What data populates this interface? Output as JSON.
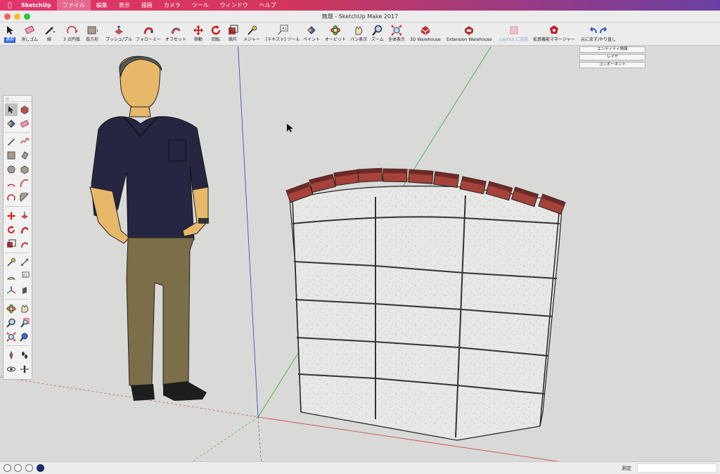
{
  "menubar": {
    "app_name": "SketchUp",
    "items": [
      "ファイル",
      "編集",
      "表示",
      "描画",
      "カメラ",
      "ツール",
      "ウィンドウ",
      "ヘルプ"
    ]
  },
  "window": {
    "title": "無題 - SketchUp Make 2017"
  },
  "toolbar": {
    "tools": [
      {
        "label": "選択",
        "icon": "select-arrow-icon"
      },
      {
        "label": "消しゴム",
        "icon": "eraser-icon"
      },
      {
        "label": "線",
        "icon": "pencil-icon"
      },
      {
        "label": "3 点円弧",
        "icon": "arc-icon"
      },
      {
        "label": "長方形",
        "icon": "rectangle-icon"
      },
      {
        "label": "プッシュ/プル",
        "icon": "push-pull-icon"
      },
      {
        "label": "フォローミー",
        "icon": "follow-me-icon"
      },
      {
        "label": "オフセット",
        "icon": "offset-icon"
      },
      {
        "label": "移動",
        "icon": "move-icon"
      },
      {
        "label": "回転",
        "icon": "rotate-icon"
      },
      {
        "label": "縮尺",
        "icon": "scale-icon"
      },
      {
        "label": "メジャー",
        "icon": "tape-measure-icon"
      },
      {
        "label": "[テキスト] ツール",
        "icon": "text-tool-icon"
      },
      {
        "label": "ペイント",
        "icon": "paint-bucket-icon"
      },
      {
        "label": "オービット",
        "icon": "orbit-icon"
      },
      {
        "label": "パン表示",
        "icon": "pan-hand-icon"
      },
      {
        "label": "ズーム",
        "icon": "zoom-icon"
      },
      {
        "label": "全体表示",
        "icon": "zoom-extents-icon"
      },
      {
        "label": "3D Warehouse",
        "icon": "3d-warehouse-icon"
      },
      {
        "label": "Extension Warehouse",
        "icon": "extension-warehouse-icon"
      },
      {
        "label": "LayOut に送信",
        "icon": "layout-send-icon"
      },
      {
        "label": "拡張機能マネージャー",
        "icon": "extension-manager-icon"
      },
      {
        "label": "元に戻す/やり直し",
        "icon": "undo-redo-icon"
      }
    ]
  },
  "inspector": {
    "buttons": [
      "エンティティ情報",
      "レイヤ",
      "コンポーネント"
    ]
  },
  "scene": {
    "colors": {
      "red_axis": "#cc3a3a",
      "green_axis": "#3aa83a",
      "blue_axis": "#3a3ad0",
      "brick": "#a5433a",
      "stone": "#e6e6e4",
      "shirt": "#262642",
      "pants": "#7b6e48",
      "skin": "#e8b86a"
    }
  },
  "statusbar": {
    "measure_label": "測定",
    "measure_value": ""
  }
}
